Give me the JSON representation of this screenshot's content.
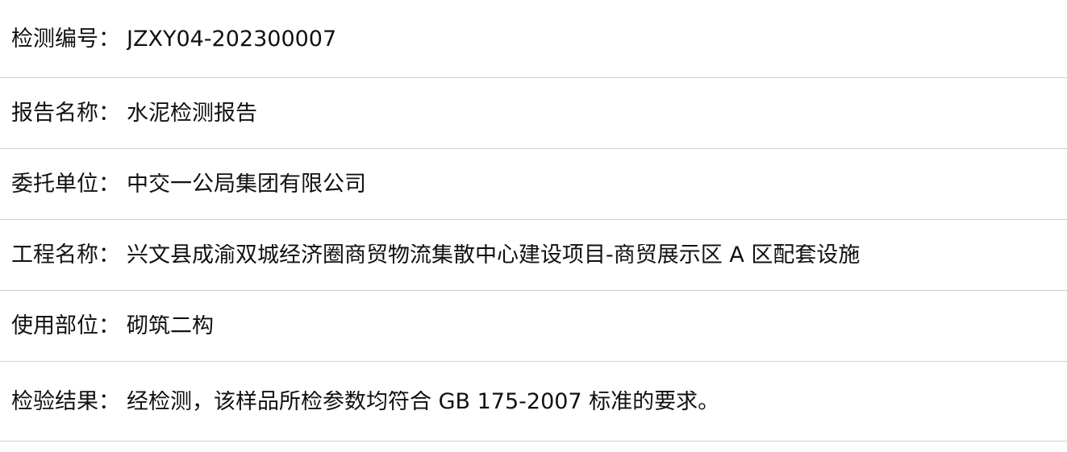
{
  "report": {
    "rows": [
      {
        "label": "检测编号",
        "value": "JZXY04-202300007"
      },
      {
        "label": "报告名称",
        "value": "水泥检测报告"
      },
      {
        "label": "委托单位",
        "value": "中交一公局集团有限公司"
      },
      {
        "label": "工程名称",
        "value": "兴文县成渝双城经济圈商贸物流集散中心建设项目-商贸展示区 A 区配套设施"
      },
      {
        "label": "使用部位",
        "value": "砌筑二构"
      },
      {
        "label": "检验结果",
        "value": "经检测，该样品所检参数均符合 GB 175-2007 标准的要求。"
      }
    ],
    "separator": "："
  }
}
